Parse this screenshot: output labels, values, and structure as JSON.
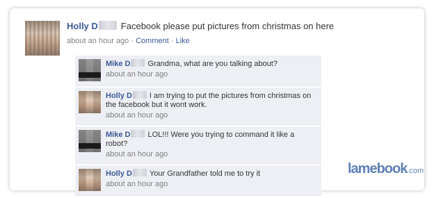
{
  "post": {
    "author": "Holly D",
    "text": "Facebook please put pictures from christmas on here",
    "time": "about an hour ago",
    "separator": "·",
    "comment_label": "Comment",
    "like_label": "Like"
  },
  "comments": [
    {
      "author": "Mike D",
      "text": "Grandma, what are you talking about?",
      "time": "about an hour ago",
      "avatar": "mike"
    },
    {
      "author": "Holly D",
      "text": "I am trying to put the pictures from christmas on the facebook but it wont work.",
      "time": "about an hour ago",
      "avatar": "holly"
    },
    {
      "author": "Mike D",
      "text": "LOL!!! Were you trying to command it like a robot?",
      "time": "about an hour ago",
      "avatar": "mike"
    },
    {
      "author": "Holly D",
      "text": "Your Grandfather told me to try it",
      "time": "about an hour ago",
      "avatar": "holly"
    }
  ],
  "watermark": {
    "brand": "lamebook",
    "suffix": ".com"
  }
}
